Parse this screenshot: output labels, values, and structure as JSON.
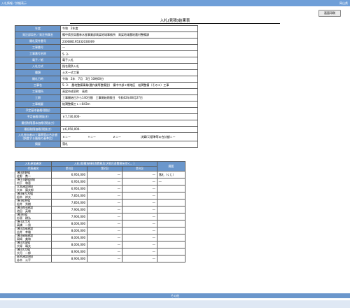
{
  "topbar": {
    "breadcrumb": "入札情報／詳細表示",
    "prefecture": "岡山県"
  },
  "print_button": "画面印刷",
  "title": "入札(見積)結果表",
  "fields": [
    {
      "label": "年度",
      "value": "令和　2年度"
    },
    {
      "label": "発注部局名／発注所属名",
      "value": "備中県民局農林水産事業部高梁地域事務所　高梁地域農地農村整備課"
    },
    {
      "label": "開札案件番号",
      "value": "230086195332030009"
    },
    {
      "label": "工事番号",
      "value": "一"
    },
    {
      "label": "工事番号名称",
      "value": "5- 3-"
    },
    {
      "label": "電子／紙",
      "value": "電子入札"
    },
    {
      "label": "入札方式",
      "value": "指名競争入札"
    },
    {
      "label": "種類",
      "value": "土木一式工事"
    },
    {
      "label": "開札日時",
      "value": "令和　2年　7月　3日 10時00分"
    },
    {
      "label": "工事名",
      "value": "5- 3-　農地整備事業(農作業等整備型)　備中中部２期地区　給潤整備（その２）工事"
    },
    {
      "label": "工事場所",
      "value": "高梁市成羽町　長地"
    },
    {
      "label": "工期",
      "value": "工事開始日から140日間　工事開始期限日　令和02年08月27日"
    },
    {
      "label": "工事概要",
      "value": "給潤整備工Ｌ＝843ｍ"
    },
    {
      "label": "予定基本価格(税抜)",
      "value": ""
    },
    {
      "label": "予定価格(税抜き)",
      "value": "￥7,730,000-"
    },
    {
      "label": "最低制限基本価格(税抜き)",
      "value": ""
    },
    {
      "label": "最低制限価格(税抜き)",
      "value": "￥6,950,000-"
    },
    {
      "label": "入札参加者の工事費等の合計額(調査する価格の基準比)",
      "value": "Ｘ＝ー　　　　　　Ｙ＝ー　　　　　　Ｚ＝ー　　　　　　　決算(1)基準等の合計額＝ー"
    },
    {
      "label": "摘要",
      "value": "落札"
    }
  ],
  "bids_table": {
    "header_name": "入札参加者名",
    "header_result": "入札(見積)結果(消費税及び地方消費税を除く。)",
    "header_note": "摘要",
    "sub_company": "代表者名",
    "sub_rounds": [
      "第1回",
      "第2回",
      "第3回"
    ],
    "rows": [
      {
        "company": "(株)佐野組",
        "rep": "佐野　勲一",
        "amount": "6,950,000",
        "r2": "―",
        "r3": "―",
        "note": "落札（くじ）"
      },
      {
        "company": "(有)小藪組(株)",
        "rep": "内下　和恵",
        "amount": "6,950,000",
        "r2": "―",
        "r3": "―",
        "note": "―"
      },
      {
        "company": "大本建設(株)",
        "rep": "大本　康夫郎",
        "amount": "6,950,000",
        "r2": "―",
        "r3": "―",
        "note": ""
      },
      {
        "company": "(株)尾々木組",
        "rep": "松木　祥夫",
        "amount": "7,850,000",
        "r2": "―",
        "r3": "―",
        "note": ""
      },
      {
        "company": "(有)松井組",
        "rep": "松井　秀樹",
        "amount": "7,850,000",
        "r2": "―",
        "r3": "―",
        "note": ""
      },
      {
        "company": "(株)池田建設",
        "rep": "池田　英雄",
        "amount": "7,900,000",
        "r2": "―",
        "r3": "―",
        "note": ""
      },
      {
        "company": "(株)杉組",
        "rep": "杉原　耕弘",
        "amount": "7,900,000",
        "r2": "―",
        "r3": "―",
        "note": ""
      },
      {
        "company": "(有)太工木",
        "rep": "高橋　一男",
        "amount": "8,000,000",
        "r2": "―",
        "r3": "―",
        "note": ""
      },
      {
        "company": "(株)吉尾建設",
        "rep": "吉井　幸雄",
        "amount": "8,000,000",
        "r2": "―",
        "r3": "―",
        "note": ""
      },
      {
        "company": "(株)岡崎建設",
        "rep": "岡崎　美和",
        "amount": "8,000,000",
        "r2": "―",
        "r3": "―",
        "note": ""
      },
      {
        "company": "(株)大塚組",
        "rep": "大塚　晴夫",
        "amount": "8,000,000",
        "r2": "―",
        "r3": "―",
        "note": ""
      },
      {
        "company": "(株)大月組",
        "rep": "大月　一郎",
        "amount": "8,900,000",
        "r2": "―",
        "r3": "―",
        "note": ""
      },
      {
        "company": "赤木建設(株)",
        "rep": "赤木　公平",
        "amount": "8,900,000",
        "r2": "―",
        "r3": "―",
        "note": ""
      }
    ]
  },
  "other_section": "その他"
}
